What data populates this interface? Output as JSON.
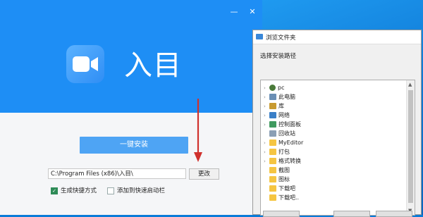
{
  "installer": {
    "minimize_glyph": "—",
    "close_glyph": "✕",
    "brand_name": "入目",
    "logo_icon": "video-camera-icon",
    "install_button": "一键安装",
    "install_path": "C:\\Program Files (x86)\\入目\\",
    "change_button": "更改",
    "options": [
      {
        "label": "生成快捷方式",
        "checked": true
      },
      {
        "label": "添加到快速启动栏",
        "checked": false
      }
    ],
    "accent_color": "#1e8ef5",
    "annotation_color": "#d0312d"
  },
  "browse_dialog": {
    "title": "浏览文件夹",
    "prompt": "选择安装路径",
    "tree": [
      {
        "label": "pc",
        "icon": "user-icon",
        "expandable": true,
        "selected": true
      },
      {
        "label": "此电脑",
        "icon": "computer-icon",
        "expandable": true
      },
      {
        "label": "库",
        "icon": "library-icon",
        "expandable": true
      },
      {
        "label": "网络",
        "icon": "network-icon",
        "expandable": true
      },
      {
        "label": "控制面板",
        "icon": "control-panel-icon",
        "expandable": true
      },
      {
        "label": "回收站",
        "icon": "recycle-bin-icon",
        "expandable": false
      },
      {
        "label": "MyEditor",
        "icon": "folder-icon",
        "expandable": true
      },
      {
        "label": "打包",
        "icon": "folder-icon",
        "expandable": true
      },
      {
        "label": "格式转换",
        "icon": "folder-icon",
        "expandable": true
      },
      {
        "label": "截图",
        "icon": "folder-icon",
        "expandable": false
      },
      {
        "label": "图标",
        "icon": "folder-icon",
        "expandable": false
      },
      {
        "label": "下载吧",
        "icon": "folder-icon",
        "expandable": false
      },
      {
        "label": "下载吧..",
        "icon": "folder-icon",
        "expandable": false
      }
    ]
  }
}
